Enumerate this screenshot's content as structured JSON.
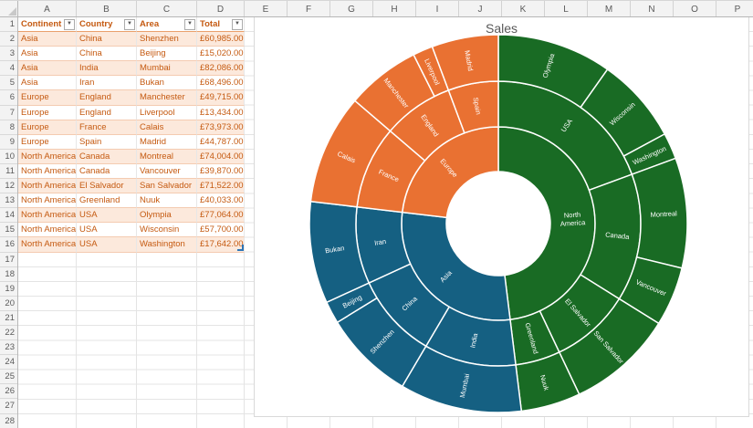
{
  "spreadsheet": {
    "column_letters": [
      "A",
      "B",
      "C",
      "D",
      "E",
      "F",
      "G",
      "H",
      "I",
      "J",
      "K",
      "L",
      "M",
      "N",
      "O",
      "P"
    ],
    "visible_rows": 28,
    "table": {
      "headers": [
        "Continent",
        "Country",
        "Area",
        "Total"
      ],
      "rows": [
        [
          "Asia",
          "China",
          "Shenzhen",
          "£60,985.00"
        ],
        [
          "Asia",
          "China",
          "Beijing",
          "£15,020.00"
        ],
        [
          "Asia",
          "India",
          "Mumbai",
          "£82,086.00"
        ],
        [
          "Asia",
          "Iran",
          "Bukan",
          "£68,496.00"
        ],
        [
          "Europe",
          "England",
          "Manchester",
          "£49,715.00"
        ],
        [
          "Europe",
          "England",
          "Liverpool",
          "£13,434.00"
        ],
        [
          "Europe",
          "France",
          "Calais",
          "£73,973.00"
        ],
        [
          "Europe",
          "Spain",
          "Madrid",
          "£44,787.00"
        ],
        [
          "North America",
          "Canada",
          "Montreal",
          "£74,004.00"
        ],
        [
          "North America",
          "Canada",
          "Vancouver",
          "£39,870.00"
        ],
        [
          "North America",
          "El Salvador",
          "San Salvador",
          "£71,522.00"
        ],
        [
          "North America",
          "Greenland",
          "Nuuk",
          "£40,033.00"
        ],
        [
          "North America",
          "USA",
          "Olympia",
          "£77,064.00"
        ],
        [
          "North America",
          "USA",
          "Wisconsin",
          "£57,700.00"
        ],
        [
          "North America",
          "USA",
          "Washington",
          "£17,642.00"
        ]
      ]
    }
  },
  "chart_data": {
    "type": "sunburst",
    "title": "Sales",
    "legend": "none",
    "label_color": "#FFFFFF",
    "tree": [
      {
        "name": "North America",
        "color": "#196B24",
        "children": [
          {
            "name": "USA",
            "children": [
              {
                "name": "Olympia",
                "value": 77064
              },
              {
                "name": "Wisconsin",
                "value": 57700
              },
              {
                "name": "Washington",
                "value": 17642
              }
            ]
          },
          {
            "name": "Canada",
            "children": [
              {
                "name": "Montreal",
                "value": 74004
              },
              {
                "name": "Vancouver",
                "value": 39870
              }
            ]
          },
          {
            "name": "El Salvador",
            "children": [
              {
                "name": "San Salvador",
                "value": 71522
              }
            ]
          },
          {
            "name": "Greenland",
            "children": [
              {
                "name": "Nuuk",
                "value": 40033
              }
            ]
          }
        ]
      },
      {
        "name": "Asia",
        "color": "#156082",
        "children": [
          {
            "name": "India",
            "children": [
              {
                "name": "Mumbai",
                "value": 82086
              }
            ]
          },
          {
            "name": "China",
            "children": [
              {
                "name": "Shenzhen",
                "value": 60985
              },
              {
                "name": "Beijing",
                "value": 15020
              }
            ]
          },
          {
            "name": "Iran",
            "children": [
              {
                "name": "Bukan",
                "value": 68496
              }
            ]
          }
        ]
      },
      {
        "name": "Europe",
        "color": "#E97132",
        "children": [
          {
            "name": "France",
            "children": [
              {
                "name": "Calais",
                "value": 73973
              }
            ]
          },
          {
            "name": "England",
            "children": [
              {
                "name": "Manchester",
                "value": 49715
              },
              {
                "name": "Liverpool",
                "value": 13434
              }
            ]
          },
          {
            "name": "Spain",
            "children": [
              {
                "name": "Madrid",
                "value": 44787
              }
            ]
          }
        ]
      }
    ]
  }
}
